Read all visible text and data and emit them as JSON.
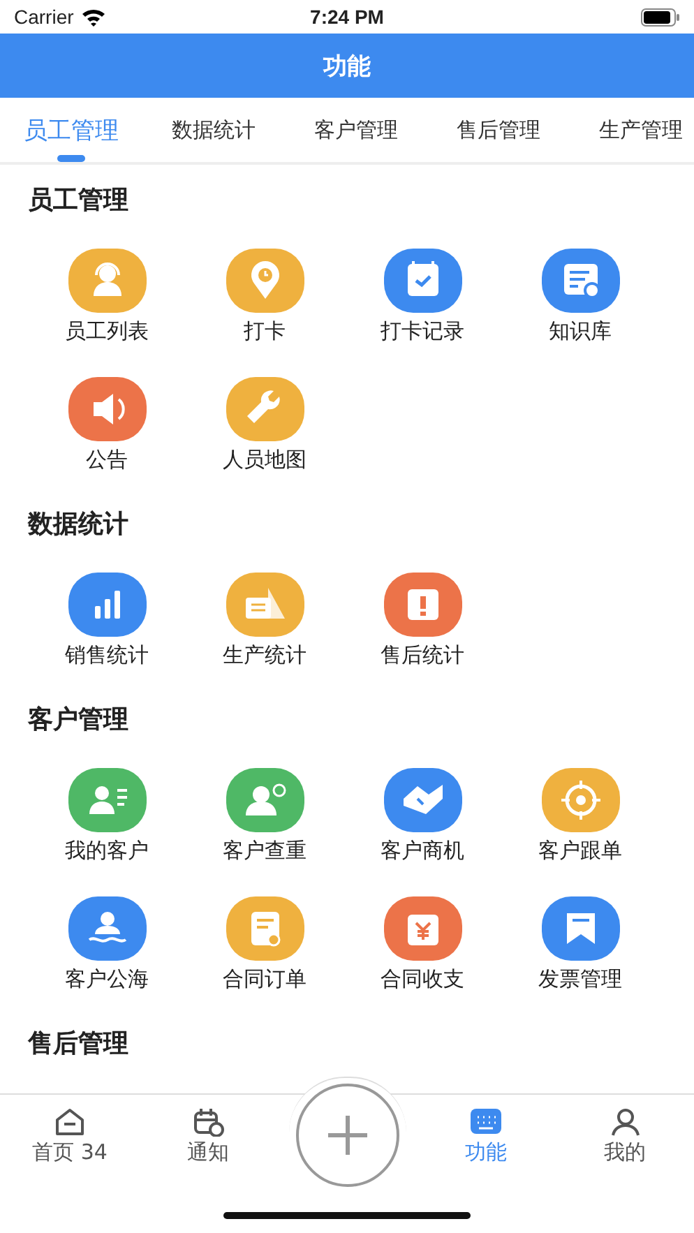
{
  "status_bar": {
    "carrier": "Carrier",
    "time": "7:24 PM"
  },
  "header": {
    "title": "功能"
  },
  "tabs": [
    {
      "label": "员工管理",
      "selected": true
    },
    {
      "label": "数据统计",
      "selected": false
    },
    {
      "label": "客户管理",
      "selected": false
    },
    {
      "label": "售后管理",
      "selected": false
    },
    {
      "label": "生产管理",
      "selected": false
    }
  ],
  "sections": [
    {
      "title": "员工管理",
      "items": [
        {
          "label": "员工列表",
          "kind": "headset",
          "color": "#efb13f"
        },
        {
          "label": "打卡",
          "kind": "pin",
          "color": "#efb13f"
        },
        {
          "label": "打卡记录",
          "kind": "calendar",
          "color": "#3d8aef"
        },
        {
          "label": "知识库",
          "kind": "document",
          "color": "#3d8aef"
        },
        {
          "label": "公告",
          "kind": "speaker",
          "color": "#ec7349"
        },
        {
          "label": "人员地图",
          "kind": "wrench",
          "color": "#efb13f"
        }
      ]
    },
    {
      "title": "数据统计",
      "items": [
        {
          "label": "销售统计",
          "kind": "bars",
          "color": "#3d8aef"
        },
        {
          "label": "生产统计",
          "kind": "ruler",
          "color": "#efb13f"
        },
        {
          "label": "售后统计",
          "kind": "alert",
          "color": "#ec7349"
        }
      ]
    },
    {
      "title": "客户管理",
      "items": [
        {
          "label": "我的客户",
          "kind": "contacts",
          "color": "#4fb866"
        },
        {
          "label": "客户查重",
          "kind": "person-target",
          "color": "#4fb866"
        },
        {
          "label": "客户商机",
          "kind": "handshake",
          "color": "#3d8aef"
        },
        {
          "label": "客户跟单",
          "kind": "target",
          "color": "#efb13f"
        },
        {
          "label": "客户公海",
          "kind": "wave",
          "color": "#3d8aef"
        },
        {
          "label": "合同订单",
          "kind": "contract",
          "color": "#efb13f"
        },
        {
          "label": "合同收支",
          "kind": "yen",
          "color": "#ec7349"
        },
        {
          "label": "发票管理",
          "kind": "bookmark",
          "color": "#3d8aef"
        }
      ]
    },
    {
      "title": "售后管理"
    }
  ],
  "tab_bar": {
    "items": [
      {
        "label": "首页 34",
        "kind": "home",
        "selected": false
      },
      {
        "label": "通知",
        "kind": "calendar",
        "selected": false
      },
      {
        "kind": "plus",
        "selected": false
      },
      {
        "label": "功能",
        "kind": "keyboard",
        "selected": true
      },
      {
        "label": "我的",
        "kind": "person",
        "selected": false
      }
    ]
  }
}
